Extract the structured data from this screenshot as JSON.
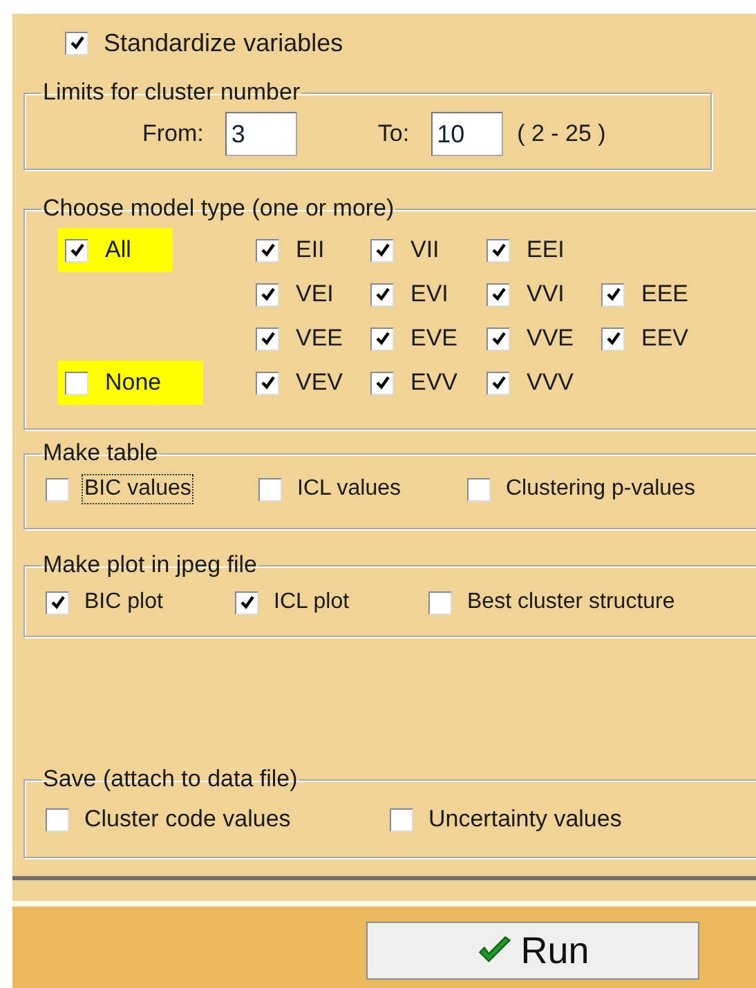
{
  "standardize": {
    "label": "Standardize variables",
    "checked": true
  },
  "limits": {
    "title": "Limits for cluster number",
    "from_label": "From:",
    "from_value": "3",
    "to_label": "To:",
    "to_value": "10",
    "range": "( 2 - 25 )"
  },
  "model_type": {
    "title": "Choose model type (one or more)",
    "all": {
      "label": "All",
      "checked": true
    },
    "none": {
      "label": "None",
      "checked": false
    },
    "rows": [
      [
        {
          "label": "EII",
          "checked": true
        },
        {
          "label": "VII",
          "checked": true
        },
        {
          "label": "EEI",
          "checked": true
        }
      ],
      [
        {
          "label": "VEI",
          "checked": true
        },
        {
          "label": "EVI",
          "checked": true
        },
        {
          "label": "VVI",
          "checked": true
        },
        {
          "label": "EEE",
          "checked": true
        }
      ],
      [
        {
          "label": "VEE",
          "checked": true
        },
        {
          "label": "EVE",
          "checked": true
        },
        {
          "label": "VVE",
          "checked": true
        },
        {
          "label": "EEV",
          "checked": true
        }
      ],
      [
        {
          "label": "VEV",
          "checked": true
        },
        {
          "label": "EVV",
          "checked": true
        },
        {
          "label": "VVV",
          "checked": true
        }
      ]
    ]
  },
  "make_table": {
    "title": "Make table",
    "options": [
      {
        "label": "BIC values",
        "checked": false,
        "focused": true
      },
      {
        "label": "ICL values",
        "checked": false,
        "focused": false
      },
      {
        "label": "Clustering p-values",
        "checked": false,
        "focused": false
      }
    ]
  },
  "make_plot": {
    "title": "Make plot in jpeg file",
    "options": [
      {
        "label": "BIC plot",
        "checked": true
      },
      {
        "label": "ICL plot",
        "checked": true
      },
      {
        "label": "Best cluster structure",
        "checked": false
      }
    ]
  },
  "save": {
    "title": "Save (attach to data file)",
    "options": [
      {
        "label": "Cluster code values",
        "checked": false
      },
      {
        "label": "Uncertainty values",
        "checked": false
      }
    ]
  },
  "run_button": {
    "label": "Run"
  }
}
